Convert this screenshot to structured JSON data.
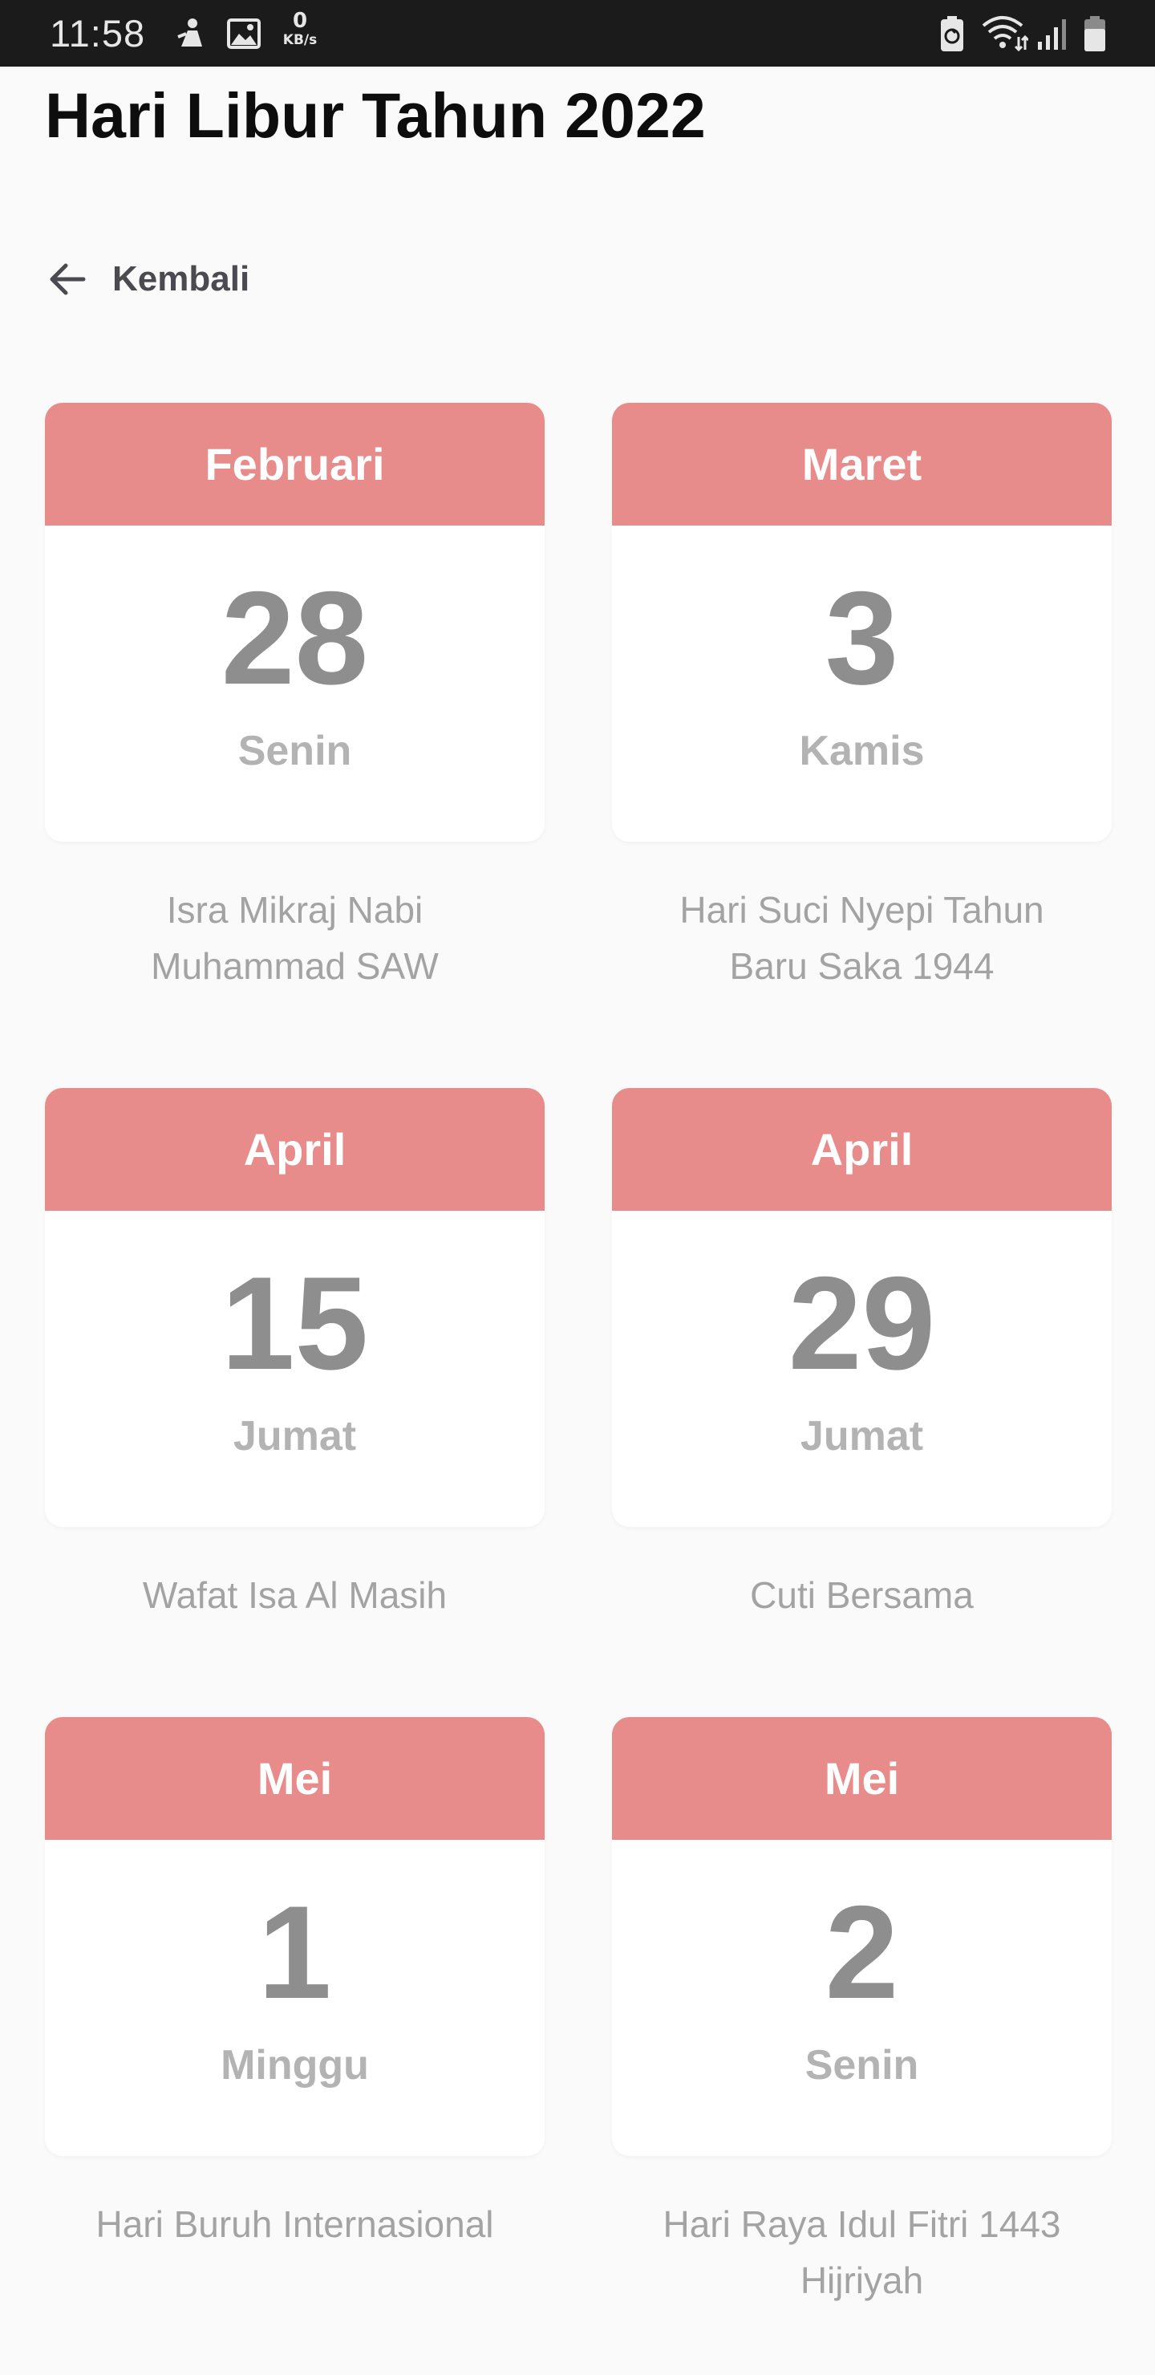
{
  "status_bar": {
    "time": "11:58",
    "speed_value": "0",
    "speed_unit": "KB/s",
    "icons": [
      "notification-icon",
      "image-icon",
      "battery-saver-icon",
      "wifi-icon",
      "signal-icon",
      "battery-icon"
    ]
  },
  "page": {
    "title": "Hari Libur Tahun 2022",
    "back_label": "Kembali"
  },
  "colors": {
    "header_bg": "#e88b8b",
    "day_number": "#8e8e8e",
    "weekday": "#b3b3b3",
    "holiday_text": "#a3a3a3",
    "background": "#fafafa"
  },
  "holidays": [
    {
      "month": "Februari",
      "day": "28",
      "weekday": "Senin",
      "name": "Isra Mikraj Nabi Muhammad SAW"
    },
    {
      "month": "Maret",
      "day": "3",
      "weekday": "Kamis",
      "name": "Hari Suci Nyepi Tahun Baru Saka 1944"
    },
    {
      "month": "April",
      "day": "15",
      "weekday": "Jumat",
      "name": "Wafat Isa Al Masih"
    },
    {
      "month": "April",
      "day": "29",
      "weekday": "Jumat",
      "name": "Cuti Bersama"
    },
    {
      "month": "Mei",
      "day": "1",
      "weekday": "Minggu",
      "name": "Hari Buruh Internasional"
    },
    {
      "month": "Mei",
      "day": "2",
      "weekday": "Senin",
      "name": "Hari Raya Idul Fitri 1443 Hijriyah"
    }
  ]
}
